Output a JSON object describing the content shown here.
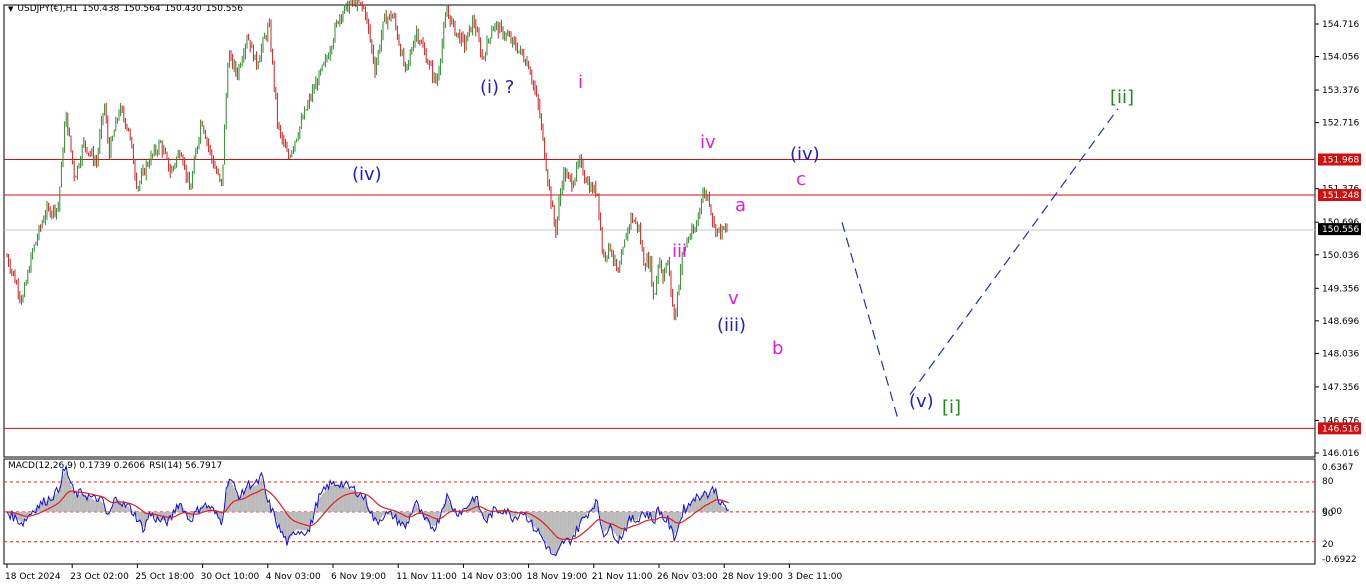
{
  "header": {
    "dropdown_glyph": "▼",
    "symbol": "USDJPY(€),H1",
    "ohlc": [
      "150.438",
      "150.564",
      "150.430",
      "150.556"
    ]
  },
  "indicator": {
    "macd_label": "MACD(12,26,9) 0.1739 0.2606",
    "rsi_label": "RSI(14) 56.7917"
  },
  "colors": {
    "bull_candle": "#2e8b2e",
    "bear_candle": "#cc2222",
    "horizontal_line": "#d01010",
    "pink_label": "#e020d0",
    "blue_label": "#2020c8",
    "green_label": "#1a8a1a",
    "projection": "#2030c0",
    "macd_hist": "#b8b8b8",
    "macd_signal": "#e02020",
    "rsi_line": "#1010e0",
    "level_dotted": "#e02020"
  },
  "chart_data": [
    {
      "type": "candlestick",
      "symbol": "USDJPY",
      "timeframe": "H1",
      "ylim": [
        146.016,
        155.2
      ],
      "y_ticks": [
        "154.716",
        "154.056",
        "153.376",
        "152.716",
        "151.968",
        "151.376",
        "151.248",
        "150.696",
        "150.556",
        "150.036",
        "149.356",
        "148.696",
        "148.036",
        "147.356",
        "146.676",
        "146.516",
        "146.016"
      ],
      "x_ticks": [
        "18 Oct 2024",
        "23 Oct 02:00",
        "25 Oct 18:00",
        "30 Oct 10:00",
        "4 Nov 03:00",
        "6 Nov 19:00",
        "11 Nov 11:00",
        "14 Nov 03:00",
        "18 Nov 19:00",
        "21 Nov 11:00",
        "26 Nov 03:00",
        "28 Nov 19:00",
        "3 Dec 11:00"
      ],
      "current_price": "150.556",
      "horizontal_levels": [
        "151.968",
        "151.248",
        "146.516"
      ],
      "price_path": [
        [
          0,
          150.0
        ],
        [
          1.2,
          149.1
        ],
        [
          2,
          150.1
        ],
        [
          3,
          150.9
        ],
        [
          4,
          151.0
        ],
        [
          4.6,
          152.9
        ],
        [
          5.3,
          151.6
        ],
        [
          6,
          152.3
        ],
        [
          7,
          151.9
        ],
        [
          7.6,
          153.1
        ],
        [
          8,
          152.1
        ],
        [
          8.8,
          153.0
        ],
        [
          9.5,
          152.6
        ],
        [
          10.2,
          151.4
        ],
        [
          11,
          151.9
        ],
        [
          12,
          152.3
        ],
        [
          12.8,
          151.7
        ],
        [
          13.6,
          152.2
        ],
        [
          14.3,
          151.3
        ],
        [
          15.2,
          152.8
        ],
        [
          16,
          152.0
        ],
        [
          16.8,
          151.4
        ],
        [
          17.3,
          154.1
        ],
        [
          18,
          153.7
        ],
        [
          18.8,
          154.5
        ],
        [
          19.5,
          153.9
        ],
        [
          20.5,
          154.7
        ],
        [
          21.2,
          152.6
        ],
        [
          22,
          152.0
        ],
        [
          23,
          152.7
        ],
        [
          24,
          153.4
        ],
        [
          25,
          154.0
        ],
        [
          26,
          154.9
        ],
        [
          27.2,
          155.2
        ],
        [
          28,
          155.0
        ],
        [
          28.8,
          153.8
        ],
        [
          29.5,
          154.8
        ],
        [
          30.2,
          154.9
        ],
        [
          31.2,
          153.7
        ],
        [
          32,
          154.6
        ],
        [
          32.7,
          154.1
        ],
        [
          33.6,
          153.5
        ],
        [
          34.4,
          155.0
        ],
        [
          35,
          154.6
        ],
        [
          35.8,
          154.3
        ],
        [
          36.5,
          154.8
        ],
        [
          37.2,
          154.0
        ],
        [
          38,
          154.7
        ],
        [
          39,
          154.5
        ],
        [
          40,
          154.2
        ],
        [
          40.8,
          153.9
        ],
        [
          41.6,
          153.0
        ],
        [
          42.3,
          151.6
        ],
        [
          42.9,
          150.5
        ],
        [
          43.5,
          151.7
        ],
        [
          44.2,
          151.5
        ],
        [
          44.8,
          151.9
        ],
        [
          45.6,
          151.4
        ],
        [
          46.2,
          151.3
        ],
        [
          46.6,
          150.0
        ],
        [
          47.2,
          150.2
        ],
        [
          47.8,
          149.6
        ],
        [
          48.4,
          150.4
        ],
        [
          48.8,
          150.8
        ],
        [
          49.4,
          150.6
        ],
        [
          49.8,
          149.9
        ],
        [
          50.3,
          149.9
        ],
        [
          50.6,
          149.1
        ],
        [
          51,
          150.0
        ],
        [
          51.3,
          149.6
        ],
        [
          51.7,
          149.9
        ],
        [
          52.2,
          148.7
        ],
        [
          52.8,
          150.0
        ],
        [
          53.3,
          150.4
        ],
        [
          53.8,
          150.5
        ],
        [
          54.4,
          151.3
        ],
        [
          54.9,
          151.2
        ],
        [
          55.3,
          150.6
        ],
        [
          55.8,
          150.5
        ],
        [
          56.5,
          150.56
        ]
      ],
      "annotations": [
        {
          "text": "(iv)",
          "color": "blue",
          "near": "6 Nov 19:00",
          "price": 151.4
        },
        {
          "text": "(i) ?",
          "color": "blue",
          "near": "14 Nov 03:00",
          "price": 153.6
        },
        {
          "text": "i",
          "color": "pink",
          "near": "21 Nov 11:00",
          "price": 153.7
        },
        {
          "text": "iv",
          "color": "pink",
          "near": "26 Nov 03:00",
          "price": 152.4
        },
        {
          "text": "iii",
          "color": "pink",
          "near": "26 Nov 03:00",
          "price": 150.1
        },
        {
          "text": "a",
          "color": "pink",
          "near": "28 Nov 19:00",
          "price": 150.8
        },
        {
          "text": "v",
          "color": "pink",
          "near": "28 Nov 19:00",
          "price": 149.3
        },
        {
          "text": "(iii)",
          "color": "blue",
          "near": "28 Nov 19:00",
          "price": 148.6
        },
        {
          "text": "b",
          "color": "pink",
          "near": "3 Dec 11:00",
          "price": 148.0
        },
        {
          "text": "(iv)",
          "color": "blue",
          "near": "3 Dec 11:00",
          "price": 152.1
        },
        {
          "text": "c",
          "color": "pink",
          "near": "3 Dec 11:00",
          "price": 151.6
        },
        {
          "text": "(v)",
          "color": "blue",
          "near": "projection",
          "price": 146.9
        },
        {
          "text": "[i]",
          "color": "green",
          "near": "projection",
          "price": 146.8
        },
        {
          "text": "[ii]",
          "color": "green",
          "near": "projection",
          "price": 153.3
        }
      ],
      "projection": [
        {
          "from": 150.696,
          "to": 146.7,
          "style": "dashed"
        },
        {
          "from": 147.2,
          "to": 153.0,
          "style": "dashed"
        }
      ]
    },
    {
      "type": "line",
      "title": "MACD(12,26,9) 0.1739 0.2606 / RSI(14) 56.7917",
      "macd_ylim": [
        -0.6922,
        0.6367
      ],
      "macd_ticks": [
        "0.6367",
        "0.00",
        "-0.6922"
      ],
      "rsi_ticks": [
        "80",
        "50",
        "20"
      ],
      "rsi_levels": [
        80,
        50,
        20
      ],
      "rsi_current": 56.7917
    }
  ]
}
